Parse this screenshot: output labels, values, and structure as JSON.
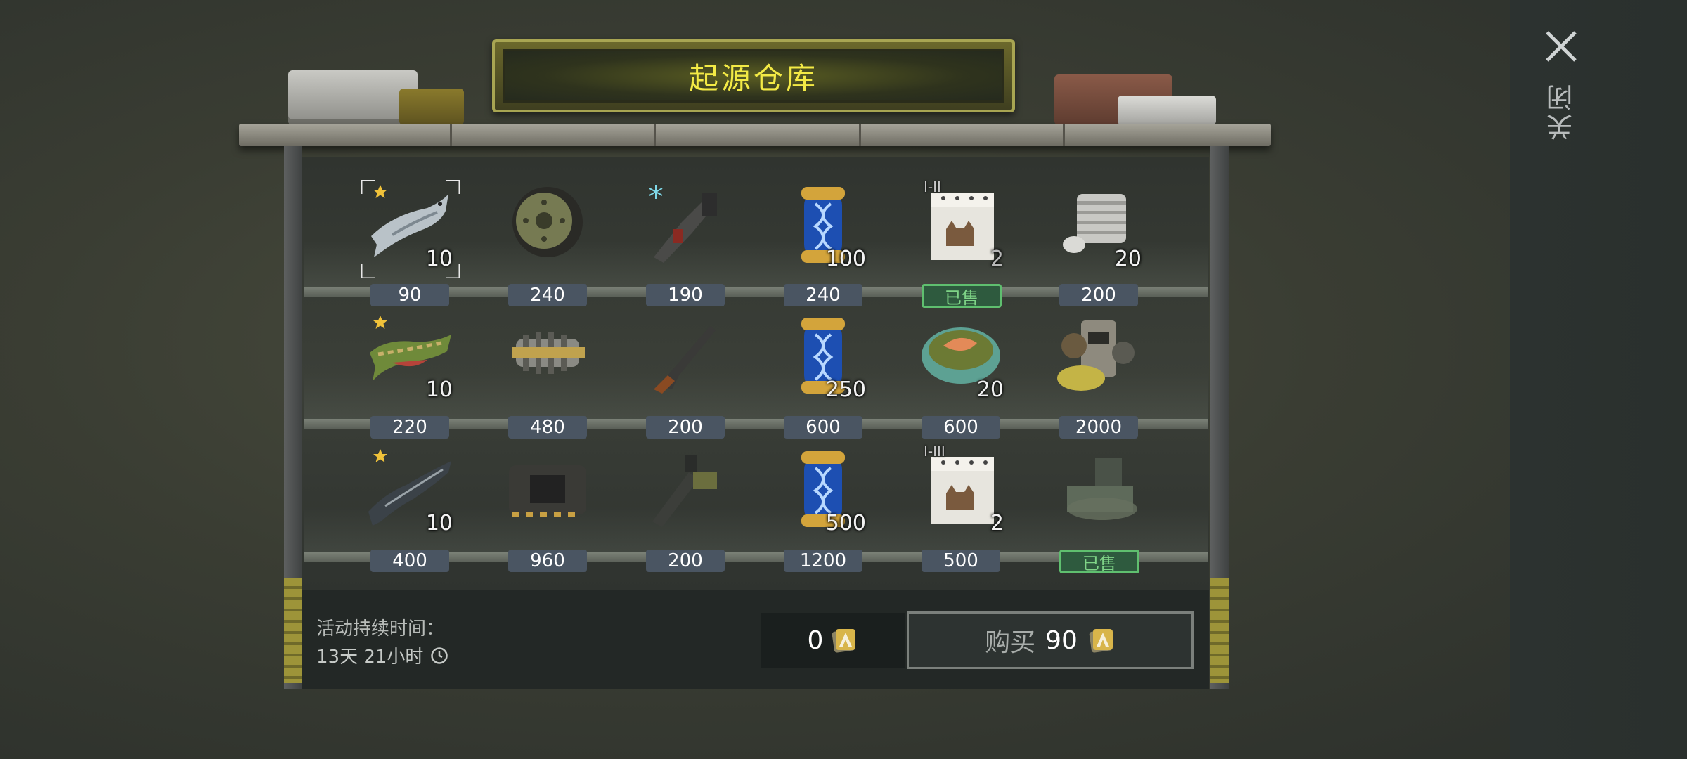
{
  "title": "起源仓库",
  "close": {
    "label": "关闭",
    "icon": "close-icon"
  },
  "footer": {
    "duration_label": "活动持续时间：",
    "duration_value": "13天 21小时",
    "balance": "0",
    "buy_label": "购买",
    "buy_price": "90"
  },
  "colors": {
    "title": "#f3ea45",
    "price_tag": "#4a5562",
    "sold": "#5fbf6f"
  },
  "rows": [
    [
      {
        "icon": "salmon-fish-icon",
        "qty": "10",
        "price": "90",
        "star": true,
        "selected": true
      },
      {
        "icon": "wheel-icon",
        "qty": "",
        "price": "240"
      },
      {
        "icon": "pipe-wrench-icon",
        "qty": "",
        "price": "190",
        "badge": "snowflake"
      },
      {
        "icon": "dna-capsule-icon",
        "qty": "100",
        "price": "240"
      },
      {
        "icon": "cat-crate-icon",
        "qty": "2",
        "price": "已售",
        "tier": "I-II",
        "sold": true
      },
      {
        "icon": "engine-cylinder-icon",
        "qty": "20",
        "price": "200"
      }
    ],
    [
      {
        "icon": "pike-fish-icon",
        "qty": "10",
        "price": "220",
        "star": true
      },
      {
        "icon": "gear-shaft-icon",
        "qty": "",
        "price": "480"
      },
      {
        "icon": "rifle-icon",
        "qty": "",
        "price": "200"
      },
      {
        "icon": "dna-capsule-icon",
        "qty": "250",
        "price": "600"
      },
      {
        "icon": "salmon-bowl-icon",
        "qty": "20",
        "price": "600"
      },
      {
        "icon": "gear-pile-icon",
        "qty": "",
        "price": "2000"
      }
    ],
    [
      {
        "icon": "sturgeon-fish-icon",
        "qty": "10",
        "price": "400",
        "star": true
      },
      {
        "icon": "circuit-board-icon",
        "qty": "",
        "price": "960"
      },
      {
        "icon": "launcher-icon",
        "qty": "",
        "price": "200"
      },
      {
        "icon": "dna-capsule-icon",
        "qty": "500",
        "price": "1200"
      },
      {
        "icon": "cat-crate-icon",
        "qty": "2",
        "price": "500",
        "tier": "I-III"
      },
      {
        "icon": "workbench-icon",
        "qty": "",
        "price": "已售",
        "sold": true
      }
    ]
  ]
}
